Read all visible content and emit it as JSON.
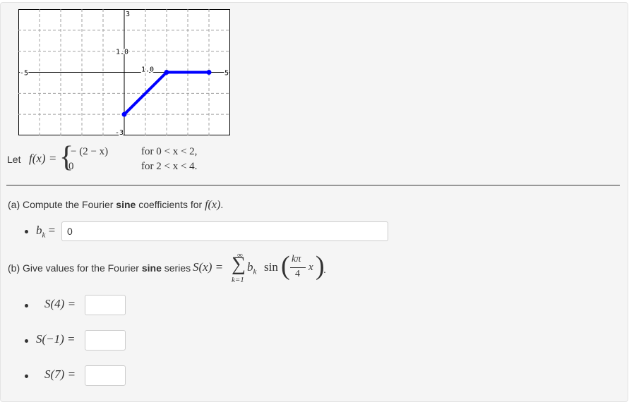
{
  "chart_data": {
    "type": "line",
    "xlim": [
      -5,
      5
    ],
    "ylim": [
      -3,
      3
    ],
    "grid": true,
    "tick_labels": {
      "x_left": "-5",
      "x_right": "5",
      "x_one": "1.0",
      "y_top": "3",
      "y_one": "1.0",
      "y_bottom": "-3"
    },
    "series": [
      {
        "color": "#0000ff",
        "points": [
          [
            0,
            -2
          ],
          [
            2,
            0
          ],
          [
            4,
            0
          ]
        ]
      }
    ]
  },
  "definition": {
    "let": "Let",
    "lhs": "f(x) =",
    "case1_expr": "− (2 − x)",
    "case1_cond": "for  0 < x < 2,",
    "case2_expr": "0",
    "case2_cond": "for  2 < x < 4."
  },
  "part_a": {
    "prefix": "(a) Compute the Fourier",
    "bold": "sine",
    "suffix": "coefficients for",
    "fx": "f(x)",
    "period": ".",
    "bk_label": "b",
    "bk_sub": "k",
    "equals": "=",
    "bk_value": "0"
  },
  "part_b": {
    "prefix": "(b) Give values for the Fourier",
    "bold": "sine",
    "suffix": "series",
    "sx": "S(x) =",
    "sum_top": "∞",
    "sum_sign": "∑",
    "sum_bottom": "k=1",
    "bk": "b",
    "bk_sub": "k",
    "sin": "sin",
    "frac_num": "kπ",
    "frac_den": "4",
    "x": "x",
    "period": ".",
    "items": [
      {
        "label": "S(4) =",
        "value": ""
      },
      {
        "label": "S(−1) =",
        "value": ""
      },
      {
        "label": "S(7) =",
        "value": ""
      }
    ]
  }
}
